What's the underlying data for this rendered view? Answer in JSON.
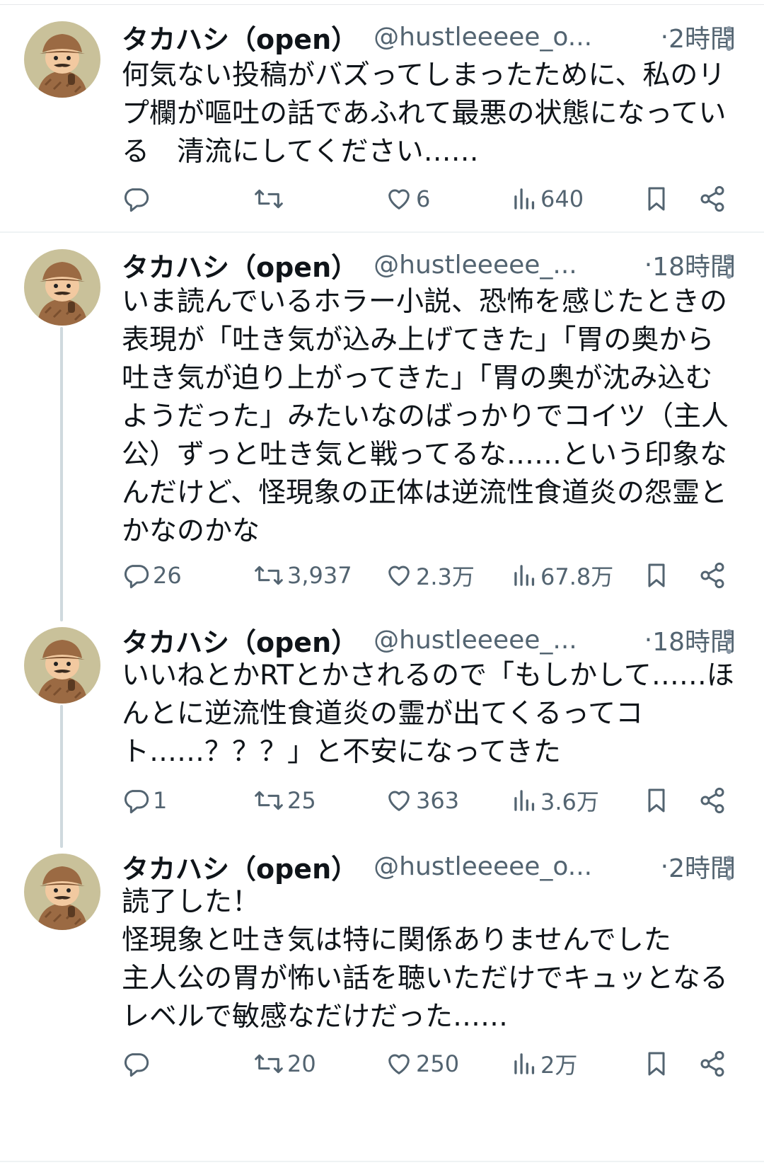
{
  "tweets": [
    {
      "name": "タカハシ（open）",
      "handle": "@hustleeeee_o...",
      "separator": "·",
      "time": "2時間",
      "text": "何気ない投稿がバズってしまったために、私のリプ欄が嘔吐の話であふれて最悪の状態になっている　清流にしてください……",
      "replies": "",
      "retweets": "",
      "likes": "6",
      "views": "640"
    },
    {
      "name": "タカハシ（open）",
      "handle": "@hustleeeee_...",
      "separator": "·",
      "time": "18時間",
      "text": "いま読んでいるホラー小説、恐怖を感じたときの表現が「吐き気が込み上げてきた」「胃の奥から吐き気が迫り上がってきた」「胃の奥が沈み込むようだった」みたいなのばっかりでコイツ（主人公）ずっと吐き気と戦ってるな……という印象なんだけど、怪現象の正体は逆流性食道炎の怨霊とかなのかな",
      "replies": "26",
      "retweets": "3,937",
      "likes": "2.3万",
      "views": "67.8万"
    },
    {
      "name": "タカハシ（open）",
      "handle": "@hustleeeee_...",
      "separator": "·",
      "time": "18時間",
      "text": "いいねとかRTとかされるので「もしかして……ほんとに逆流性食道炎の霊が出てくるってコト……？？？」と不安になってきた",
      "replies": "1",
      "retweets": "25",
      "likes": "363",
      "views": "3.6万"
    },
    {
      "name": "タカハシ（open）",
      "handle": "@hustleeeee_o...",
      "separator": "·",
      "time": "2時間",
      "text": "読了した！\n怪現象と吐き気は特に関係ありませんでした\n主人公の胃が怖い話を聴いただけでキュッとなるレベルで敏感なだけだった……",
      "replies": "",
      "retweets": "20",
      "likes": "250",
      "views": "2万"
    }
  ],
  "icons": {
    "reply": "reply-icon",
    "retweet": "retweet-icon",
    "like": "heart-icon",
    "views": "views-icon",
    "bookmark": "bookmark-icon",
    "share": "share-icon",
    "more": "more-icon"
  },
  "colors": {
    "text": "#0f1419",
    "secondary": "#536471",
    "thread_line": "#cfd9de",
    "avatar_bg": "#c9c19a"
  }
}
